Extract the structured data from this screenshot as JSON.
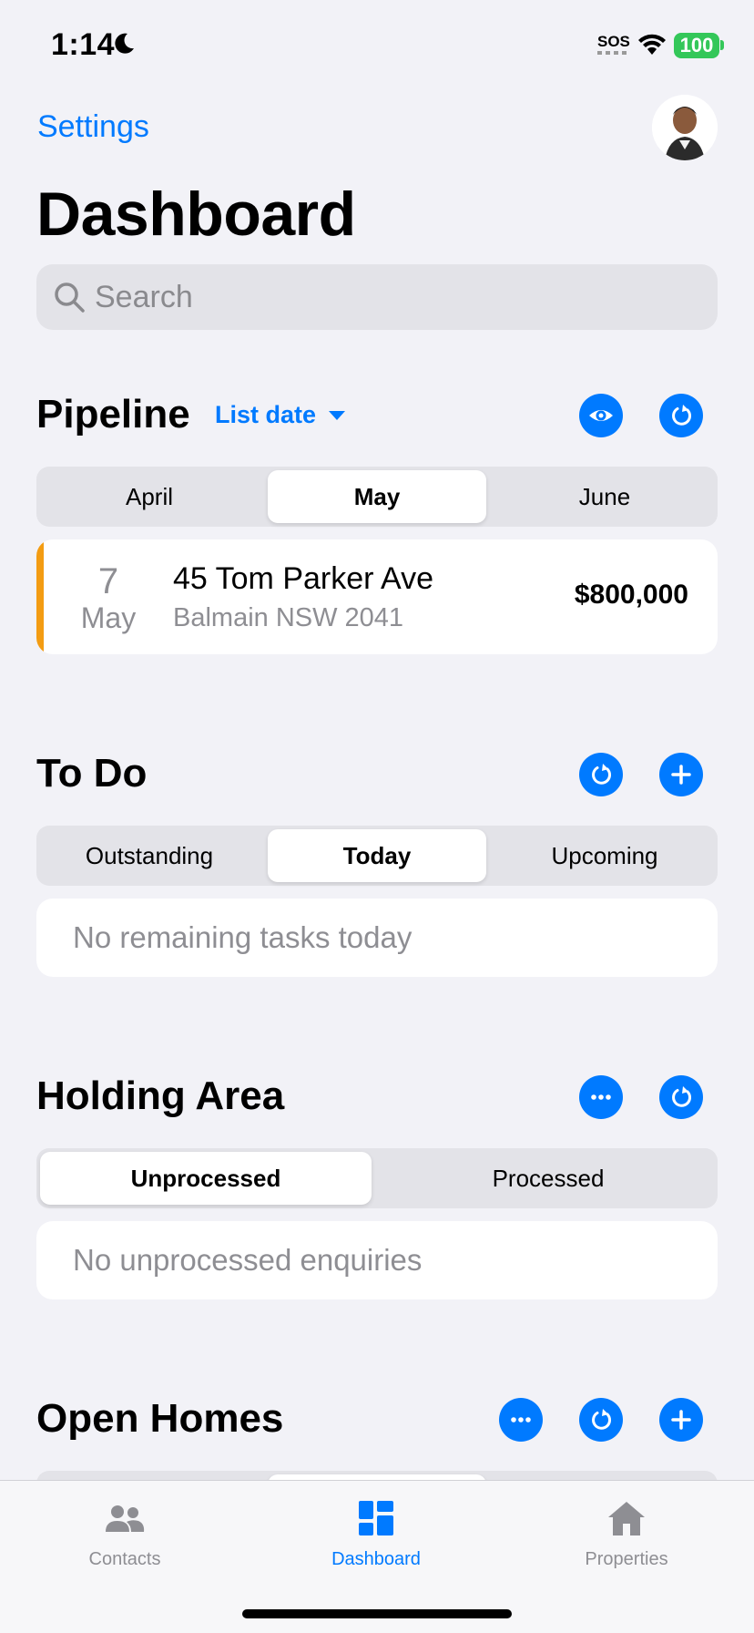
{
  "status_bar": {
    "time": "1:14",
    "sos": "SOS",
    "battery": "100"
  },
  "nav": {
    "settings_label": "Settings",
    "title": "Dashboard"
  },
  "search": {
    "placeholder": "Search",
    "value": ""
  },
  "pipeline": {
    "title": "Pipeline",
    "filter_label": "List date",
    "segments": [
      "April",
      "May",
      "June"
    ],
    "active_segment": "May",
    "deals": [
      {
        "day": "7",
        "month": "May",
        "address": "45 Tom Parker Ave",
        "suburb": "Balmain NSW 2041",
        "price": "$800,000",
        "accent": "#F39C12"
      }
    ]
  },
  "todo": {
    "title": "To Do",
    "segments": [
      "Outstanding",
      "Today",
      "Upcoming"
    ],
    "active_segment": "Today",
    "empty_text": "No remaining tasks today"
  },
  "holding_area": {
    "title": "Holding Area",
    "segments": [
      "Unprocessed",
      "Processed"
    ],
    "active_segment": "Unprocessed",
    "empty_text": "No unprocessed enquiries"
  },
  "open_homes": {
    "title": "Open Homes"
  },
  "tab_bar": {
    "items": [
      {
        "label": "Contacts",
        "icon": "people-icon",
        "active": false
      },
      {
        "label": "Dashboard",
        "icon": "dashboard-icon",
        "active": true
      },
      {
        "label": "Properties",
        "icon": "house-icon",
        "active": false
      }
    ]
  },
  "colors": {
    "accent": "#007AFF",
    "pipeline_accent": "#F39C12",
    "battery": "#34C759",
    "background": "#F2F2F7"
  }
}
